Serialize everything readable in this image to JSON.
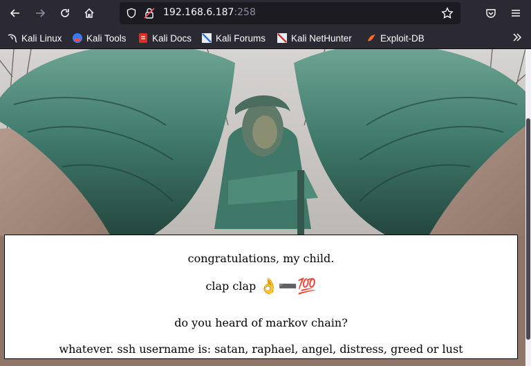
{
  "browser": {
    "url_host": "192.168.6.187",
    "url_port": ":258"
  },
  "bookmarks": [
    {
      "label": "Kali Linux",
      "icon": "kali-dragon-icon"
    },
    {
      "label": "Kali Tools",
      "icon": "kali-tools-icon"
    },
    {
      "label": "Kali Docs",
      "icon": "kali-docs-icon"
    },
    {
      "label": "Kali Forums",
      "icon": "kali-forums-icon"
    },
    {
      "label": "Kali NetHunter",
      "icon": "kali-nethunter-icon"
    },
    {
      "label": "Exploit-DB",
      "icon": "exploit-db-icon"
    }
  ],
  "page": {
    "line1": "congratulations, my child.",
    "line2_text": "clap clap ",
    "line2_emoji_ok": "👌",
    "line2_emoji_minus": "➖",
    "line2_emoji_100": "💯",
    "line3": "do you heard of markov chain?",
    "line4": "whatever. ssh username is: satan, raphael, angel, distress, greed or lust"
  },
  "colors": {
    "chrome": "#2b2a33",
    "urlbar": "#1c1b22",
    "statue_patina": "#4e8a7a",
    "stone": "#a08a7c"
  }
}
